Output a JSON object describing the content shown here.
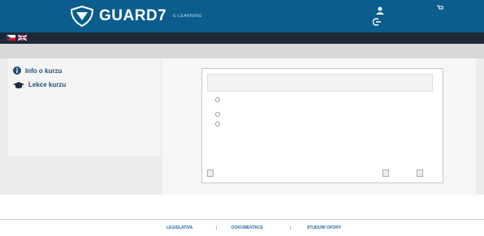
{
  "colors": {
    "header_bg": "#0a5d8c",
    "menubar_bg": "#1d2836",
    "link": "#3a7ab0"
  },
  "header": {
    "brand": "GUARD7",
    "brand_sub": "E-LEARNING",
    "user_icon": "user-icon",
    "logout_label": "",
    "logout_icon": "logout-icon",
    "cart_icon": "cart-icon",
    "cart_label": ""
  },
  "menu": {
    "items": [
      "",
      "",
      "",
      "",
      "",
      "",
      ""
    ]
  },
  "sidebar": {
    "info_title": "Info o kurzu",
    "lesson_title": "Lekce kurzu",
    "links": [
      "",
      "",
      "",
      "",
      "",
      ""
    ]
  },
  "quiz": {
    "question": "",
    "options": [
      "",
      "",
      ""
    ],
    "submit_label": "",
    "counter": "",
    "prev_label": "",
    "next_label": ""
  },
  "footer": {
    "links": [
      "LEGISLATIVA",
      "DOKUMENTACE",
      "STUDIJNÍ OPORY"
    ]
  }
}
